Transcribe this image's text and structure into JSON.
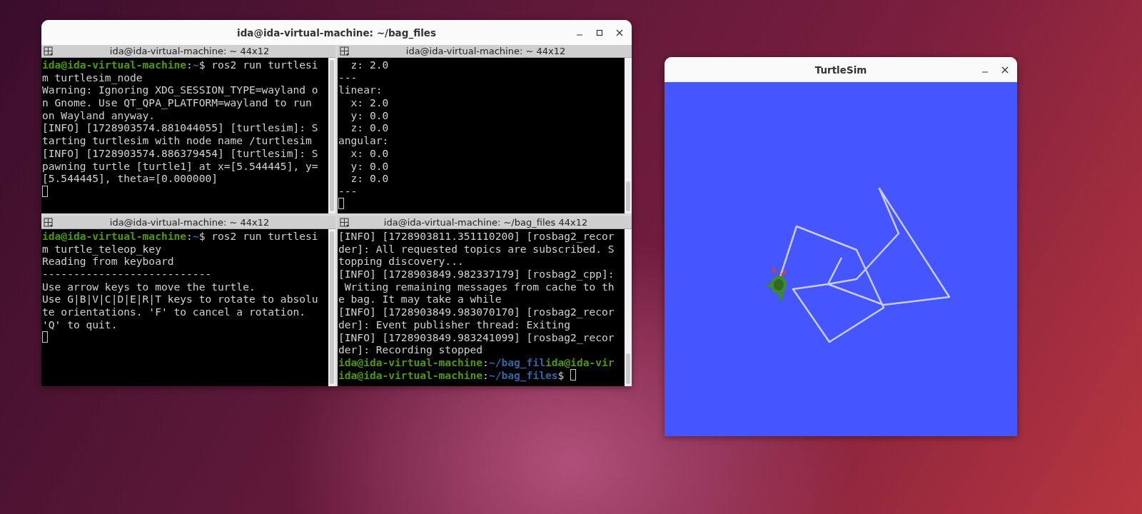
{
  "terminal_window": {
    "title": "ida@ida-virtual-machine: ~/bag_files",
    "panes": [
      {
        "title": "ida@ida-virtual-machine: ~ 44x12",
        "lines": [
          {
            "segments": [
              {
                "kind": "host",
                "text": "ida@ida-virtual-machine"
              },
              {
                "kind": "text",
                "text": ":"
              },
              {
                "kind": "path",
                "text": "~"
              },
              {
                "kind": "text",
                "text": "$ ros2 run turtlesi"
              }
            ]
          },
          {
            "segments": [
              {
                "kind": "text",
                "text": "m turtlesim_node"
              }
            ]
          },
          {
            "segments": [
              {
                "kind": "text",
                "text": "Warning: Ignoring XDG_SESSION_TYPE=wayland o"
              }
            ]
          },
          {
            "segments": [
              {
                "kind": "text",
                "text": "n Gnome. Use QT_QPA_PLATFORM=wayland to run"
              }
            ]
          },
          {
            "segments": [
              {
                "kind": "text",
                "text": "on Wayland anyway."
              }
            ]
          },
          {
            "segments": [
              {
                "kind": "text",
                "text": "[INFO] [1728903574.881044055] [turtlesim]: S"
              }
            ]
          },
          {
            "segments": [
              {
                "kind": "text",
                "text": "tarting turtlesim with node name /turtlesim"
              }
            ]
          },
          {
            "segments": [
              {
                "kind": "text",
                "text": "[INFO] [1728903574.886379454] [turtlesim]: S"
              }
            ]
          },
          {
            "segments": [
              {
                "kind": "text",
                "text": "pawning turtle [turtle1] at x=[5.544445], y="
              }
            ]
          },
          {
            "segments": [
              {
                "kind": "text",
                "text": "[5.544445], theta=[0.000000]"
              }
            ]
          },
          {
            "cursor": true
          }
        ]
      },
      {
        "title": "ida@ida-virtual-machine: ~ 44x12",
        "lines": [
          {
            "segments": [
              {
                "kind": "text",
                "text": "  z: 2.0"
              }
            ]
          },
          {
            "segments": [
              {
                "kind": "text",
                "text": "---"
              }
            ]
          },
          {
            "segments": [
              {
                "kind": "text",
                "text": "linear:"
              }
            ]
          },
          {
            "segments": [
              {
                "kind": "text",
                "text": "  x: 2.0"
              }
            ]
          },
          {
            "segments": [
              {
                "kind": "text",
                "text": "  y: 0.0"
              }
            ]
          },
          {
            "segments": [
              {
                "kind": "text",
                "text": "  z: 0.0"
              }
            ]
          },
          {
            "segments": [
              {
                "kind": "text",
                "text": "angular:"
              }
            ]
          },
          {
            "segments": [
              {
                "kind": "text",
                "text": "  x: 0.0"
              }
            ]
          },
          {
            "segments": [
              {
                "kind": "text",
                "text": "  y: 0.0"
              }
            ]
          },
          {
            "segments": [
              {
                "kind": "text",
                "text": "  z: 0.0"
              }
            ]
          },
          {
            "segments": [
              {
                "kind": "text",
                "text": "---"
              }
            ]
          },
          {
            "cursor": true
          }
        ]
      },
      {
        "title": "ida@ida-virtual-machine: ~ 44x12",
        "lines": [
          {
            "segments": [
              {
                "kind": "host",
                "text": "ida@ida-virtual-machine"
              },
              {
                "kind": "text",
                "text": ":"
              },
              {
                "kind": "path",
                "text": "~"
              },
              {
                "kind": "text",
                "text": "$ ros2 run turtlesi"
              }
            ]
          },
          {
            "segments": [
              {
                "kind": "text",
                "text": "m turtle_teleop_key"
              }
            ]
          },
          {
            "segments": [
              {
                "kind": "text",
                "text": "Reading from keyboard"
              }
            ]
          },
          {
            "segments": [
              {
                "kind": "text",
                "text": "---------------------------"
              }
            ]
          },
          {
            "segments": [
              {
                "kind": "text",
                "text": "Use arrow keys to move the turtle."
              }
            ]
          },
          {
            "segments": [
              {
                "kind": "text",
                "text": "Use G|B|V|C|D|E|R|T keys to rotate to absolu"
              }
            ]
          },
          {
            "segments": [
              {
                "kind": "text",
                "text": "te orientations. 'F' to cancel a rotation."
              }
            ]
          },
          {
            "segments": [
              {
                "kind": "text",
                "text": "'Q' to quit."
              }
            ]
          },
          {
            "cursor": true
          }
        ]
      },
      {
        "title": "ida@ida-virtual-machine: ~/bag_files 44x12",
        "lines": [
          {
            "segments": [
              {
                "kind": "text",
                "text": "[INFO] [1728903811.351110200] [rosbag2_recor"
              }
            ]
          },
          {
            "segments": [
              {
                "kind": "text",
                "text": "der]: All requested topics are subscribed. S"
              }
            ]
          },
          {
            "segments": [
              {
                "kind": "text",
                "text": "topping discovery..."
              }
            ]
          },
          {
            "segments": [
              {
                "kind": "text",
                "text": "[INFO] [1728903849.982337179] [rosbag2_cpp]:"
              }
            ]
          },
          {
            "segments": [
              {
                "kind": "text",
                "text": " Writing remaining messages from cache to th"
              }
            ]
          },
          {
            "segments": [
              {
                "kind": "text",
                "text": "e bag. It may take a while"
              }
            ]
          },
          {
            "segments": [
              {
                "kind": "text",
                "text": "[INFO] [1728903849.983070170] [rosbag2_recor"
              }
            ]
          },
          {
            "segments": [
              {
                "kind": "text",
                "text": "der]: Event publisher thread: Exiting"
              }
            ]
          },
          {
            "segments": [
              {
                "kind": "text",
                "text": "[INFO] [1728903849.983241099] [rosbag2_recor"
              }
            ]
          },
          {
            "segments": [
              {
                "kind": "text",
                "text": "der]: Recording stopped"
              }
            ]
          },
          {
            "segments": [
              {
                "kind": "host",
                "text": "ida@ida-virtual-machine"
              },
              {
                "kind": "text",
                "text": ":"
              },
              {
                "kind": "path",
                "text": "~/bag_fil"
              },
              {
                "kind": "host",
                "text": "ida@ida-vir"
              }
            ]
          },
          {
            "segments": [
              {
                "kind": "host",
                "text": "ida@ida-virtual-machine"
              },
              {
                "kind": "text",
                "text": ":"
              },
              {
                "kind": "path",
                "text": "~/bag_files"
              },
              {
                "kind": "text",
                "text": "$ "
              }
            ],
            "cursor": true
          }
        ]
      }
    ]
  },
  "turtlesim_window": {
    "title": "TurtleSim"
  }
}
